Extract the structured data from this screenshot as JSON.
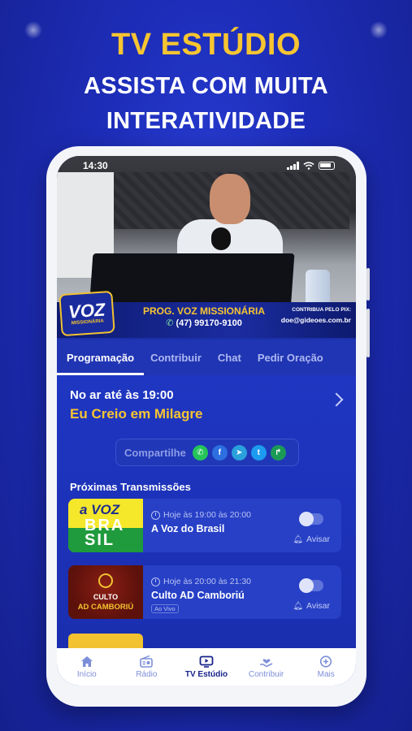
{
  "hero": {
    "title": "TV ESTÚDIO",
    "line1": "ASSISTA COM MUITA",
    "line2": "INTERATIVIDADE"
  },
  "status_bar": {
    "time": "14:30"
  },
  "video_overlay": {
    "logo_text": "VOZ",
    "logo_sub": "MISSIONÁRIA",
    "program_title": "PROG. VOZ MISSIONÁRIA",
    "phone": "(47) 99170-9100",
    "pix_label": "CONTRIBUA PELO PIX:",
    "pix_email": "doe@gideoes.com.br"
  },
  "tabs": [
    {
      "label": "Programação",
      "active": true
    },
    {
      "label": "Contribuir",
      "active": false
    },
    {
      "label": "Chat",
      "active": false
    },
    {
      "label": "Pedir Oração",
      "active": false
    }
  ],
  "now_playing": {
    "on_air_text": "No ar até às 19:00",
    "program_name": "Eu Creio em Milagre"
  },
  "share": {
    "label": "Compartilhe",
    "icons": [
      {
        "name": "whatsapp-icon",
        "glyph": "✆",
        "color": "#25c45a"
      },
      {
        "name": "facebook-icon",
        "glyph": "f",
        "color": "#2d6fe0"
      },
      {
        "name": "telegram-icon",
        "glyph": "➤",
        "color": "#2aa0dc"
      },
      {
        "name": "twitter-icon",
        "glyph": "t",
        "color": "#1d9bf0"
      },
      {
        "name": "forward-icon",
        "glyph": "↱",
        "color": "#1b9a56"
      }
    ]
  },
  "upcoming": {
    "title": "Próximas Transmissões",
    "items": [
      {
        "thumb_line1": "a VOZ",
        "thumb_line2": "BRA SIL",
        "time": "Hoje às 19:00 às 20:00",
        "name": "A Voz do Brasil",
        "badge": "",
        "notify_label": "Avisar"
      },
      {
        "thumb_line1": "CULTO",
        "thumb_line2": "AD CAMBORIÚ",
        "time": "Hoje às 20:00 às 21:30",
        "name": "Culto AD Camboriú",
        "badge": "Ao Vivo",
        "notify_label": "Avisar"
      }
    ]
  },
  "bottom_nav": [
    {
      "label": "Início",
      "icon": "home-icon",
      "active": false
    },
    {
      "label": "Rádio",
      "icon": "radio-icon",
      "active": false
    },
    {
      "label": "TV Estúdio",
      "icon": "tv-icon",
      "active": true
    },
    {
      "label": "Contribuir",
      "icon": "donate-icon",
      "active": false
    },
    {
      "label": "Mais",
      "icon": "plus-circle-icon",
      "active": false
    }
  ],
  "colors": {
    "accent_yellow": "#f7c531",
    "background_blue": "#1d2db8",
    "nav_active": "#17238a"
  }
}
